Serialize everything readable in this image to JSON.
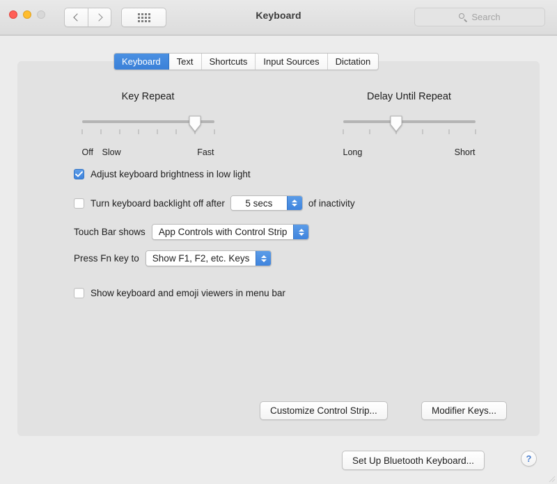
{
  "window": {
    "title": "Keyboard",
    "traffic_lights": [
      {
        "name": "close",
        "color": "#ff5f57"
      },
      {
        "name": "minimize",
        "color": "#ffbd2e"
      },
      {
        "name": "zoom",
        "color": "#d8d8d8"
      }
    ],
    "nav_back_icon": "chevron-left-icon",
    "nav_forward_icon": "chevron-right-icon",
    "show_all_icon": "grid-icon",
    "search": {
      "placeholder": "Search",
      "value": "",
      "icon": "search-icon"
    }
  },
  "tabs": [
    {
      "label": "Keyboard",
      "active": true
    },
    {
      "label": "Text",
      "active": false
    },
    {
      "label": "Shortcuts",
      "active": false
    },
    {
      "label": "Input Sources",
      "active": false
    },
    {
      "label": "Dictation",
      "active": false
    }
  ],
  "sliders": [
    {
      "title": "Key Repeat",
      "label_left": "Off",
      "label_left2": "Slow",
      "label_right": "Fast",
      "ticks": 8,
      "value_index": 7,
      "value_min": 1,
      "value_max": 8
    },
    {
      "title": "Delay Until Repeat",
      "label_left": "Long",
      "label_right": "Short",
      "ticks": 6,
      "value_index": 3,
      "value_min": 1,
      "value_max": 6
    }
  ],
  "options": {
    "brightness": {
      "label": "Adjust keyboard brightness in low light",
      "checked": true
    },
    "backlight": {
      "label": "Turn keyboard backlight off after",
      "checked": false,
      "stepper_value": "5 secs",
      "suffix": "of inactivity"
    },
    "touch_bar": {
      "label": "Touch Bar shows",
      "value": "App Controls with Control Strip"
    },
    "fn_key": {
      "label": "Press Fn key to",
      "value": "Show F1, F2, etc. Keys"
    },
    "emoji_viewers": {
      "label": "Show keyboard and emoji viewers in menu bar",
      "checked": false
    }
  },
  "buttons": {
    "customize_control_strip": "Customize Control Strip...",
    "modifier_keys": "Modifier Keys...",
    "set_up_bluetooth_keyboard": "Set Up Bluetooth Keyboard...",
    "help": "?"
  },
  "colors": {
    "accent_blue": "#4a90e2",
    "window_bg": "#ececec",
    "panel_bg": "#e2e2e2",
    "titlebar_bg": "#e2e2e2"
  }
}
